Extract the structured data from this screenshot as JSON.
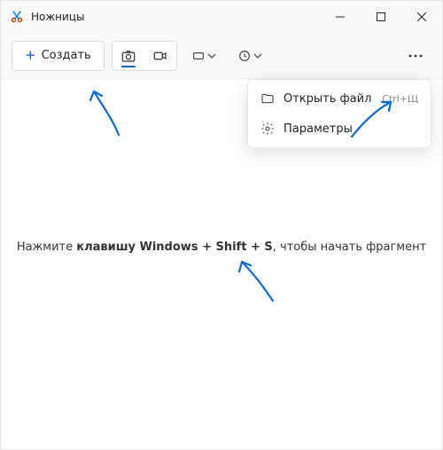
{
  "window": {
    "title": "Ножницы"
  },
  "toolbar": {
    "new_label": "Создать"
  },
  "menu": {
    "open_file": {
      "label": "Открыть файл",
      "shortcut": "Ctrl+Щ"
    },
    "settings": {
      "label": "Параметры"
    }
  },
  "hint": {
    "prefix": "Нажмите ",
    "keys": "клавишу Windows + Shift + S",
    "suffix": ", чтобы начать фрагмент"
  },
  "colors": {
    "accent": "#005fb8"
  }
}
